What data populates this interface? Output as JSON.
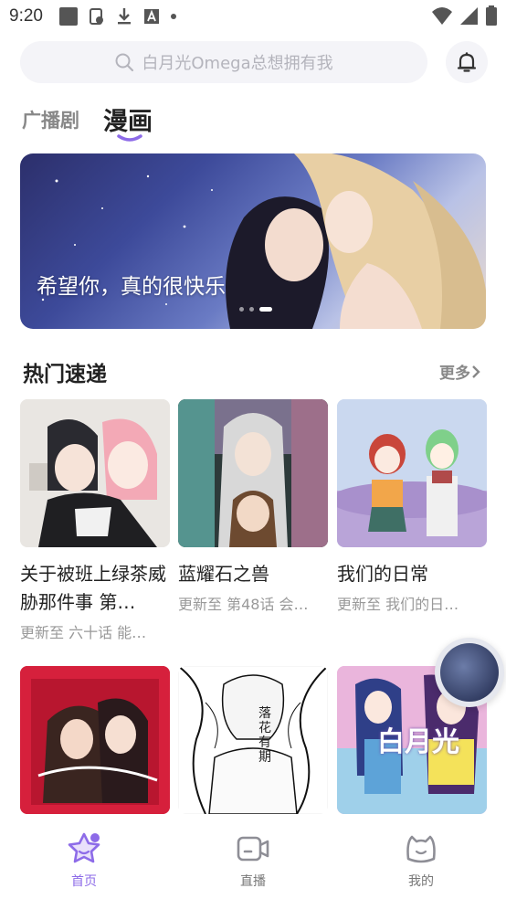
{
  "status_bar": {
    "time": "9:20"
  },
  "search": {
    "placeholder": "白月光Omega总想拥有我"
  },
  "tabs": [
    {
      "label": "广播剧",
      "active": false
    },
    {
      "label": "漫画",
      "active": true
    }
  ],
  "banner": {
    "caption": "希望你，真的很快乐",
    "slide_count": 3,
    "active_slide": 3
  },
  "section": {
    "title": "热门速递",
    "more_label": "更多"
  },
  "cards": [
    {
      "title": "关于被班上绿茶威胁那件事 第…",
      "subtitle": "更新至 六十话 能…"
    },
    {
      "title": "蓝耀石之兽",
      "subtitle": "更新至 第48话 会…"
    },
    {
      "title": "我们的日常",
      "subtitle": "更新至 我们的日…"
    },
    {
      "title": "",
      "subtitle": "",
      "cover_text": ""
    },
    {
      "title": "",
      "subtitle": "",
      "cover_text": "落花有期"
    },
    {
      "title": "",
      "subtitle": "",
      "cover_text": "白月光"
    }
  ],
  "bottom_nav": [
    {
      "label": "首页",
      "icon": "star-face-icon",
      "active": true
    },
    {
      "label": "直播",
      "icon": "video-camera-icon",
      "active": false
    },
    {
      "label": "我的",
      "icon": "cat-face-icon",
      "active": false
    }
  ],
  "colors": {
    "accent": "#8d6be8",
    "text": "#222222",
    "muted": "#999999",
    "search_bg": "#f4f4f8"
  }
}
